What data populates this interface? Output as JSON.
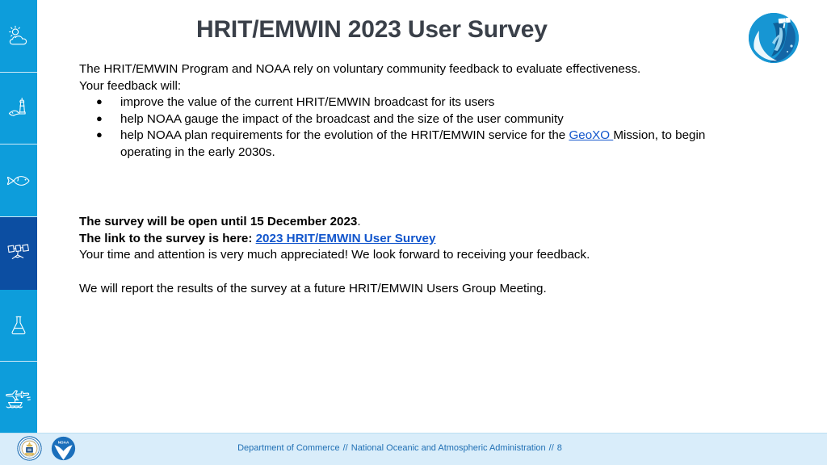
{
  "slide": {
    "title": "HRIT/EMWIN 2023 User Survey",
    "title_color": "#3a4049",
    "link_color": "#1155cc",
    "background": "#ffffff"
  },
  "sidebar": {
    "background": "#0d9ddb",
    "active_background": "#0c4ea2",
    "items": [
      {
        "icon": "weather-sun-cloud-icon",
        "label": "Weather",
        "active": false
      },
      {
        "icon": "lighthouse-coasts-icon",
        "label": "Coasts",
        "active": false
      },
      {
        "icon": "fish-fisheries-icon",
        "label": "Fisheries",
        "active": false
      },
      {
        "icon": "satellite-icon",
        "label": "Satellites",
        "active": true
      },
      {
        "icon": "flask-research-icon",
        "label": "Research",
        "active": false
      },
      {
        "icon": "aircraft-ship-marine-operations-icon",
        "label": "Marine Operations",
        "active": false
      }
    ]
  },
  "emblem": {
    "icon": "noaa-satellite-globe-logo",
    "label": "GOES-R satellite globe emblem"
  },
  "body": {
    "intro_line_1": "The HRIT/EMWIN Program and NOAA rely on voluntary community feedback to evaluate effectiveness.",
    "intro_line_2": "Your feedback will:",
    "bullets": [
      {
        "text": "improve the value of the current HRIT/EMWIN broadcast for its users"
      },
      {
        "text": "help NOAA gauge the impact of the broadcast and the size of the user community"
      },
      {
        "prefix": "help NOAA plan requirements for the evolution of the HRIT/EMWIN service for the ",
        "link": "GeoXO ",
        "suffix": "Mission, to begin",
        "wrap": "operating in the early 2030s."
      }
    ],
    "deadline_bold": "The survey will be open until 15 December 2023",
    "deadline_tail": ".",
    "link_lead_bold": "The link to the survey is here: ",
    "survey_link": "2023 HRIT/EMWIN User Survey",
    "thanks": "Your time and attention is very much appreciated! We look forward to receiving your feedback.",
    "report": "We will report the results of the survey at a future HRIT/EMWIN Users Group Meeting."
  },
  "footer": {
    "logos": [
      {
        "icon": "department-of-commerce-seal",
        "label": "Department of Commerce seal"
      },
      {
        "icon": "noaa-seagull-logo",
        "label": "NOAA logo"
      }
    ],
    "department": "Department of Commerce",
    "separator_1": "//",
    "agency": "National Oceanic and Atmospheric Administration",
    "separator_2": "//",
    "page_number": "8",
    "text_color": "#1f6fb4",
    "background": "#d9edfa"
  }
}
